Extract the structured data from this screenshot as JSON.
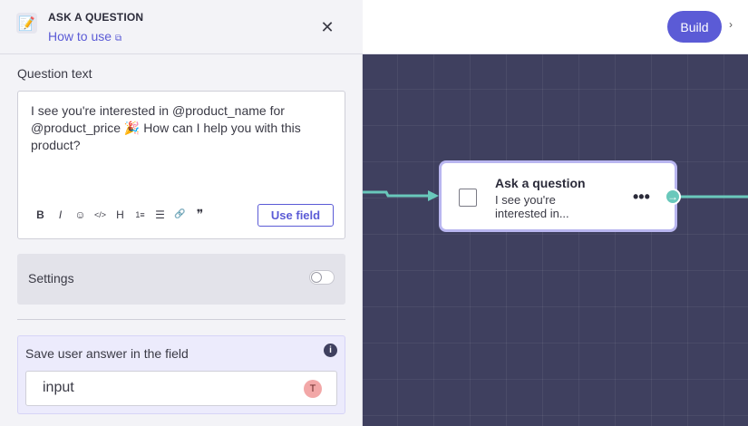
{
  "topbar": {
    "build_label": "Build",
    "more_glyph": "›"
  },
  "panel": {
    "icon": "memo-icon",
    "title": "ASK A QUESTION",
    "how_to_label": "How to use",
    "close_glyph": "✕"
  },
  "question": {
    "label": "Question text",
    "text": "I see you're interested in @product_name for @product_price  🎉 How can I help you with this product?",
    "toolbar": [
      "B",
      "I",
      "☺",
      "</>",
      "H",
      "1≡",
      "☰",
      "🔗",
      "❞"
    ],
    "use_field_label": "Use field"
  },
  "settings": {
    "label": "Settings",
    "enabled": false
  },
  "save": {
    "label": "Save user answer in the field",
    "info_glyph": "i",
    "field_value": "input",
    "field_badge": "T"
  },
  "node": {
    "title": "Ask a question",
    "desc": "I see you're interested in...",
    "menu_glyph": "•••",
    "out_glyph": "→"
  },
  "colors": {
    "accent": "#5b5bd6",
    "canvas": "#3f405f",
    "connector": "#69c8bb",
    "node_border": "#b9b6f0"
  }
}
